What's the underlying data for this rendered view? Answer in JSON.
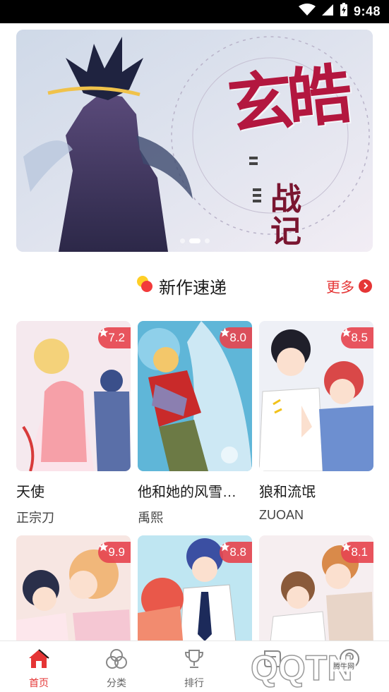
{
  "status_bar": {
    "time": "9:48"
  },
  "banner": {
    "title": "玄皓",
    "subtitle": "战记"
  },
  "section": {
    "title": "新作速递",
    "more": "更多"
  },
  "comics": [
    {
      "title": "天使",
      "author": "正宗刀",
      "rating": "7.2"
    },
    {
      "title": "他和她的风雪…",
      "author": "禹熙",
      "rating": "8.0"
    },
    {
      "title": "狼和流氓",
      "author": "ZUOAN",
      "rating": "8.5"
    },
    {
      "title": "",
      "author": "",
      "rating": "9.9"
    },
    {
      "title": "",
      "author": "",
      "rating": "8.8"
    },
    {
      "title": "",
      "author": "",
      "rating": "8.1"
    }
  ],
  "nav": [
    {
      "label": "首页",
      "icon": "home-icon",
      "active": true
    },
    {
      "label": "分类",
      "icon": "category-icon",
      "active": false
    },
    {
      "label": "排行",
      "icon": "trophy-icon",
      "active": false
    },
    {
      "label": "",
      "icon": "bookshelf-icon",
      "active": false
    },
    {
      "label": "",
      "icon": "profile-icon",
      "active": false
    }
  ],
  "watermark": {
    "text": "QQTN",
    "caption": "腾牛网"
  },
  "colors": {
    "accent": "#e53535",
    "rating_badge": "#e64650",
    "banner_title": "#b3173f"
  }
}
